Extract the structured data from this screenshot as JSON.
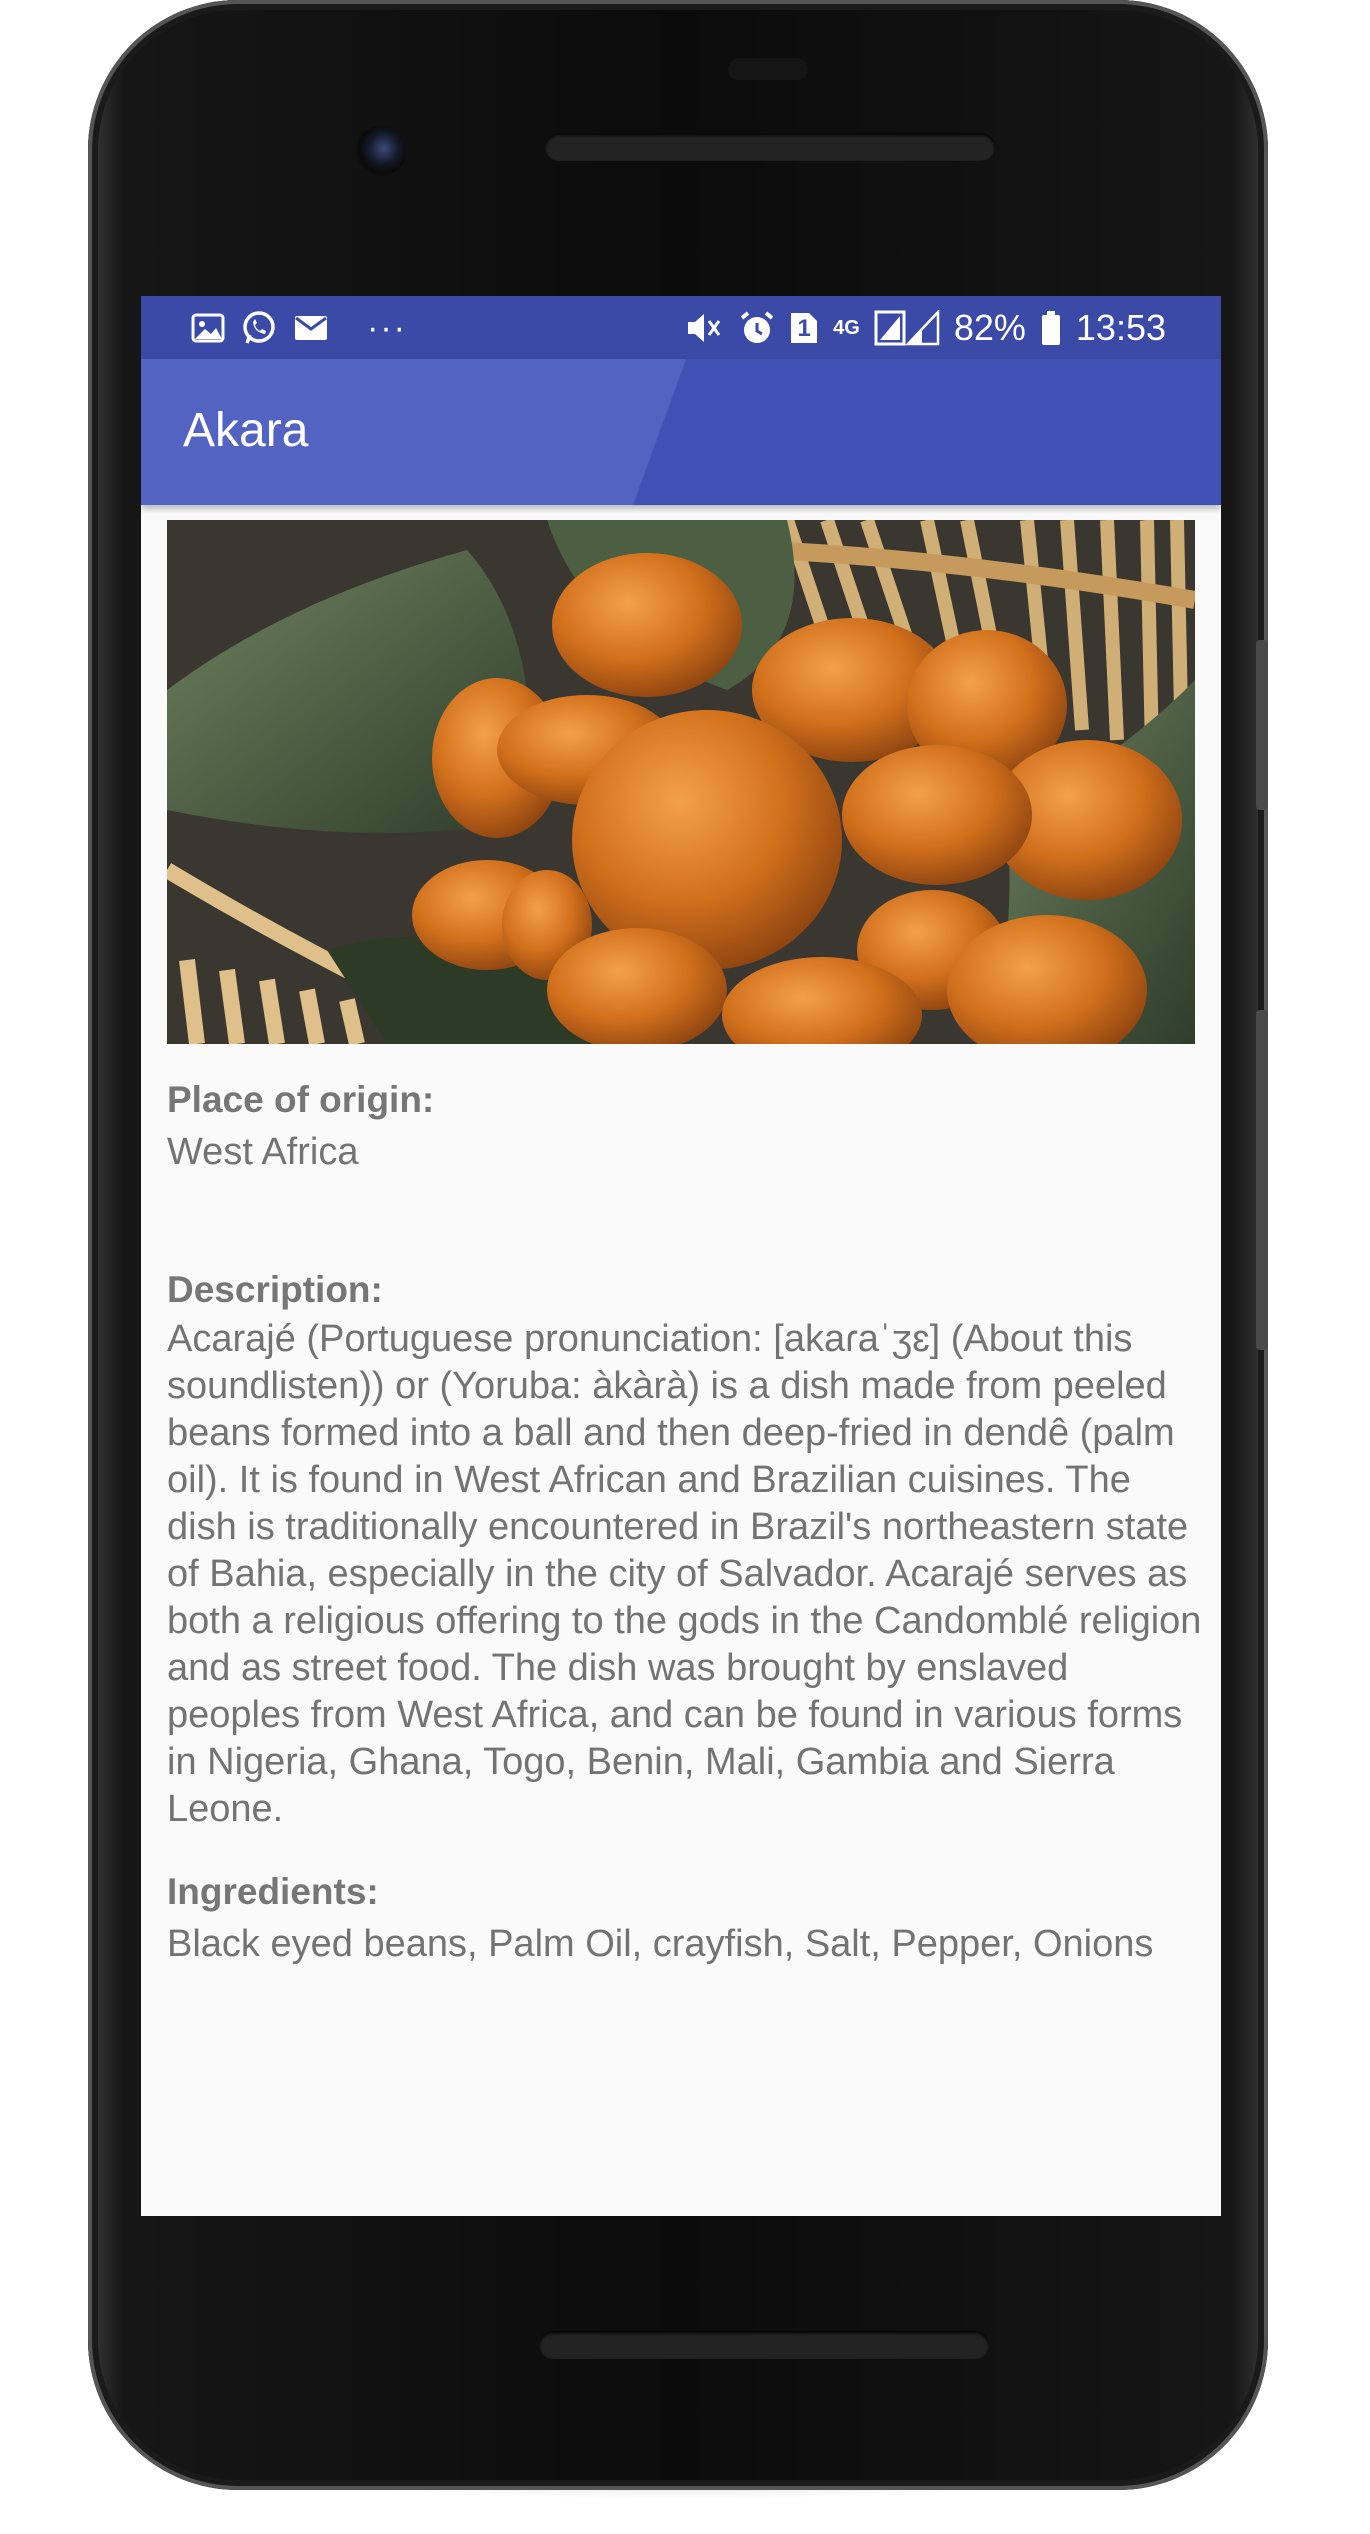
{
  "status_bar": {
    "battery": "82%",
    "time": "13:53",
    "network": "4G",
    "sim": "1",
    "overflow": "···",
    "left_icons": [
      "gallery-icon",
      "whatsapp-icon",
      "mail-icon"
    ],
    "right_icons": [
      "mute-icon",
      "alarm-icon",
      "sim-icon",
      "signal-icon",
      "battery-icon"
    ]
  },
  "app_bar": {
    "title": "Akara",
    "color": "#3f51b5"
  },
  "image": {
    "subject": "akara-fritters-photo"
  },
  "details": {
    "origin_label": "Place of origin:",
    "origin_value": "West Africa",
    "description_label": "Description:",
    "description_value": "Acarajé (Portuguese pronunciation: [akaɾaˈʒɛ] (About this soundlisten)) or (Yoruba: àkàrà) is a dish made from peeled beans formed into a ball and then deep-fried in dendê (palm oil). It is found in West African and Brazilian cuisines. The dish is traditionally encountered in Brazil's northeastern state of Bahia, especially in the city of Salvador. Acarajé serves as both a religious offering to the gods in the Candomblé religion and as street food. The dish was brought by enslaved peoples from West Africa, and can be found in various forms in Nigeria, Ghana, Togo, Benin, Mali, Gambia and Sierra Leone.",
    "ingredients_label": "Ingredients:",
    "ingredients_value": "Black eyed beans, Palm Oil, crayfish, Salt, Pepper, Onions"
  }
}
